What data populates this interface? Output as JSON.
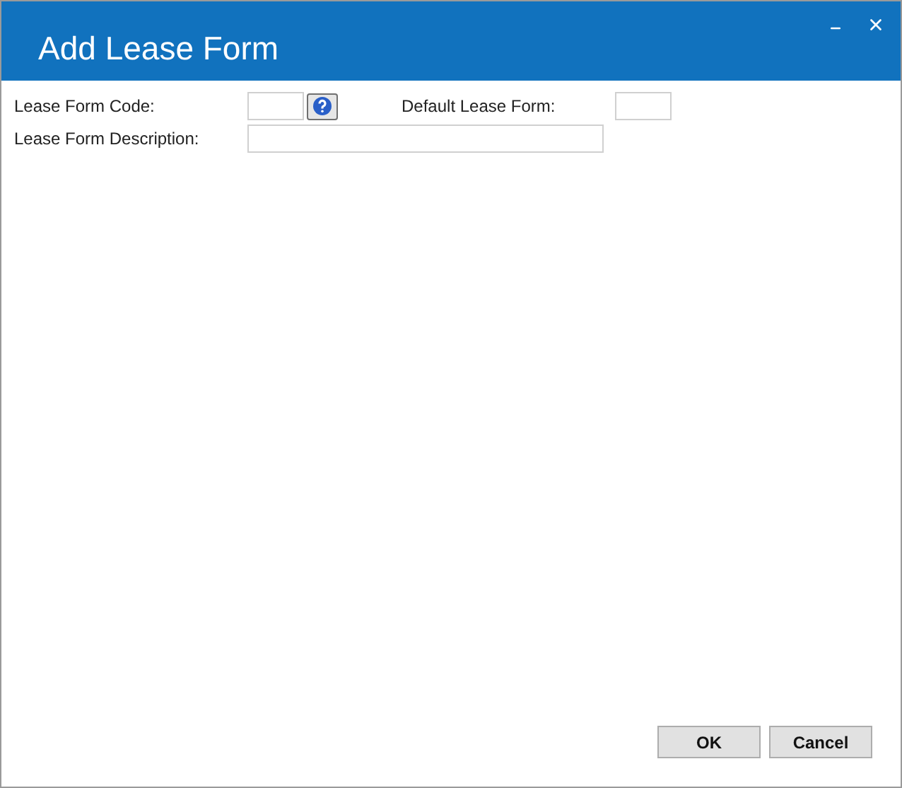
{
  "window": {
    "title": "Add Lease Form"
  },
  "fields": {
    "code_label": "Lease Form Code:",
    "default_label": "Default Lease Form:",
    "description_label": "Lease Form Description:"
  },
  "buttons": [
    "OK",
    "Cancel"
  ]
}
